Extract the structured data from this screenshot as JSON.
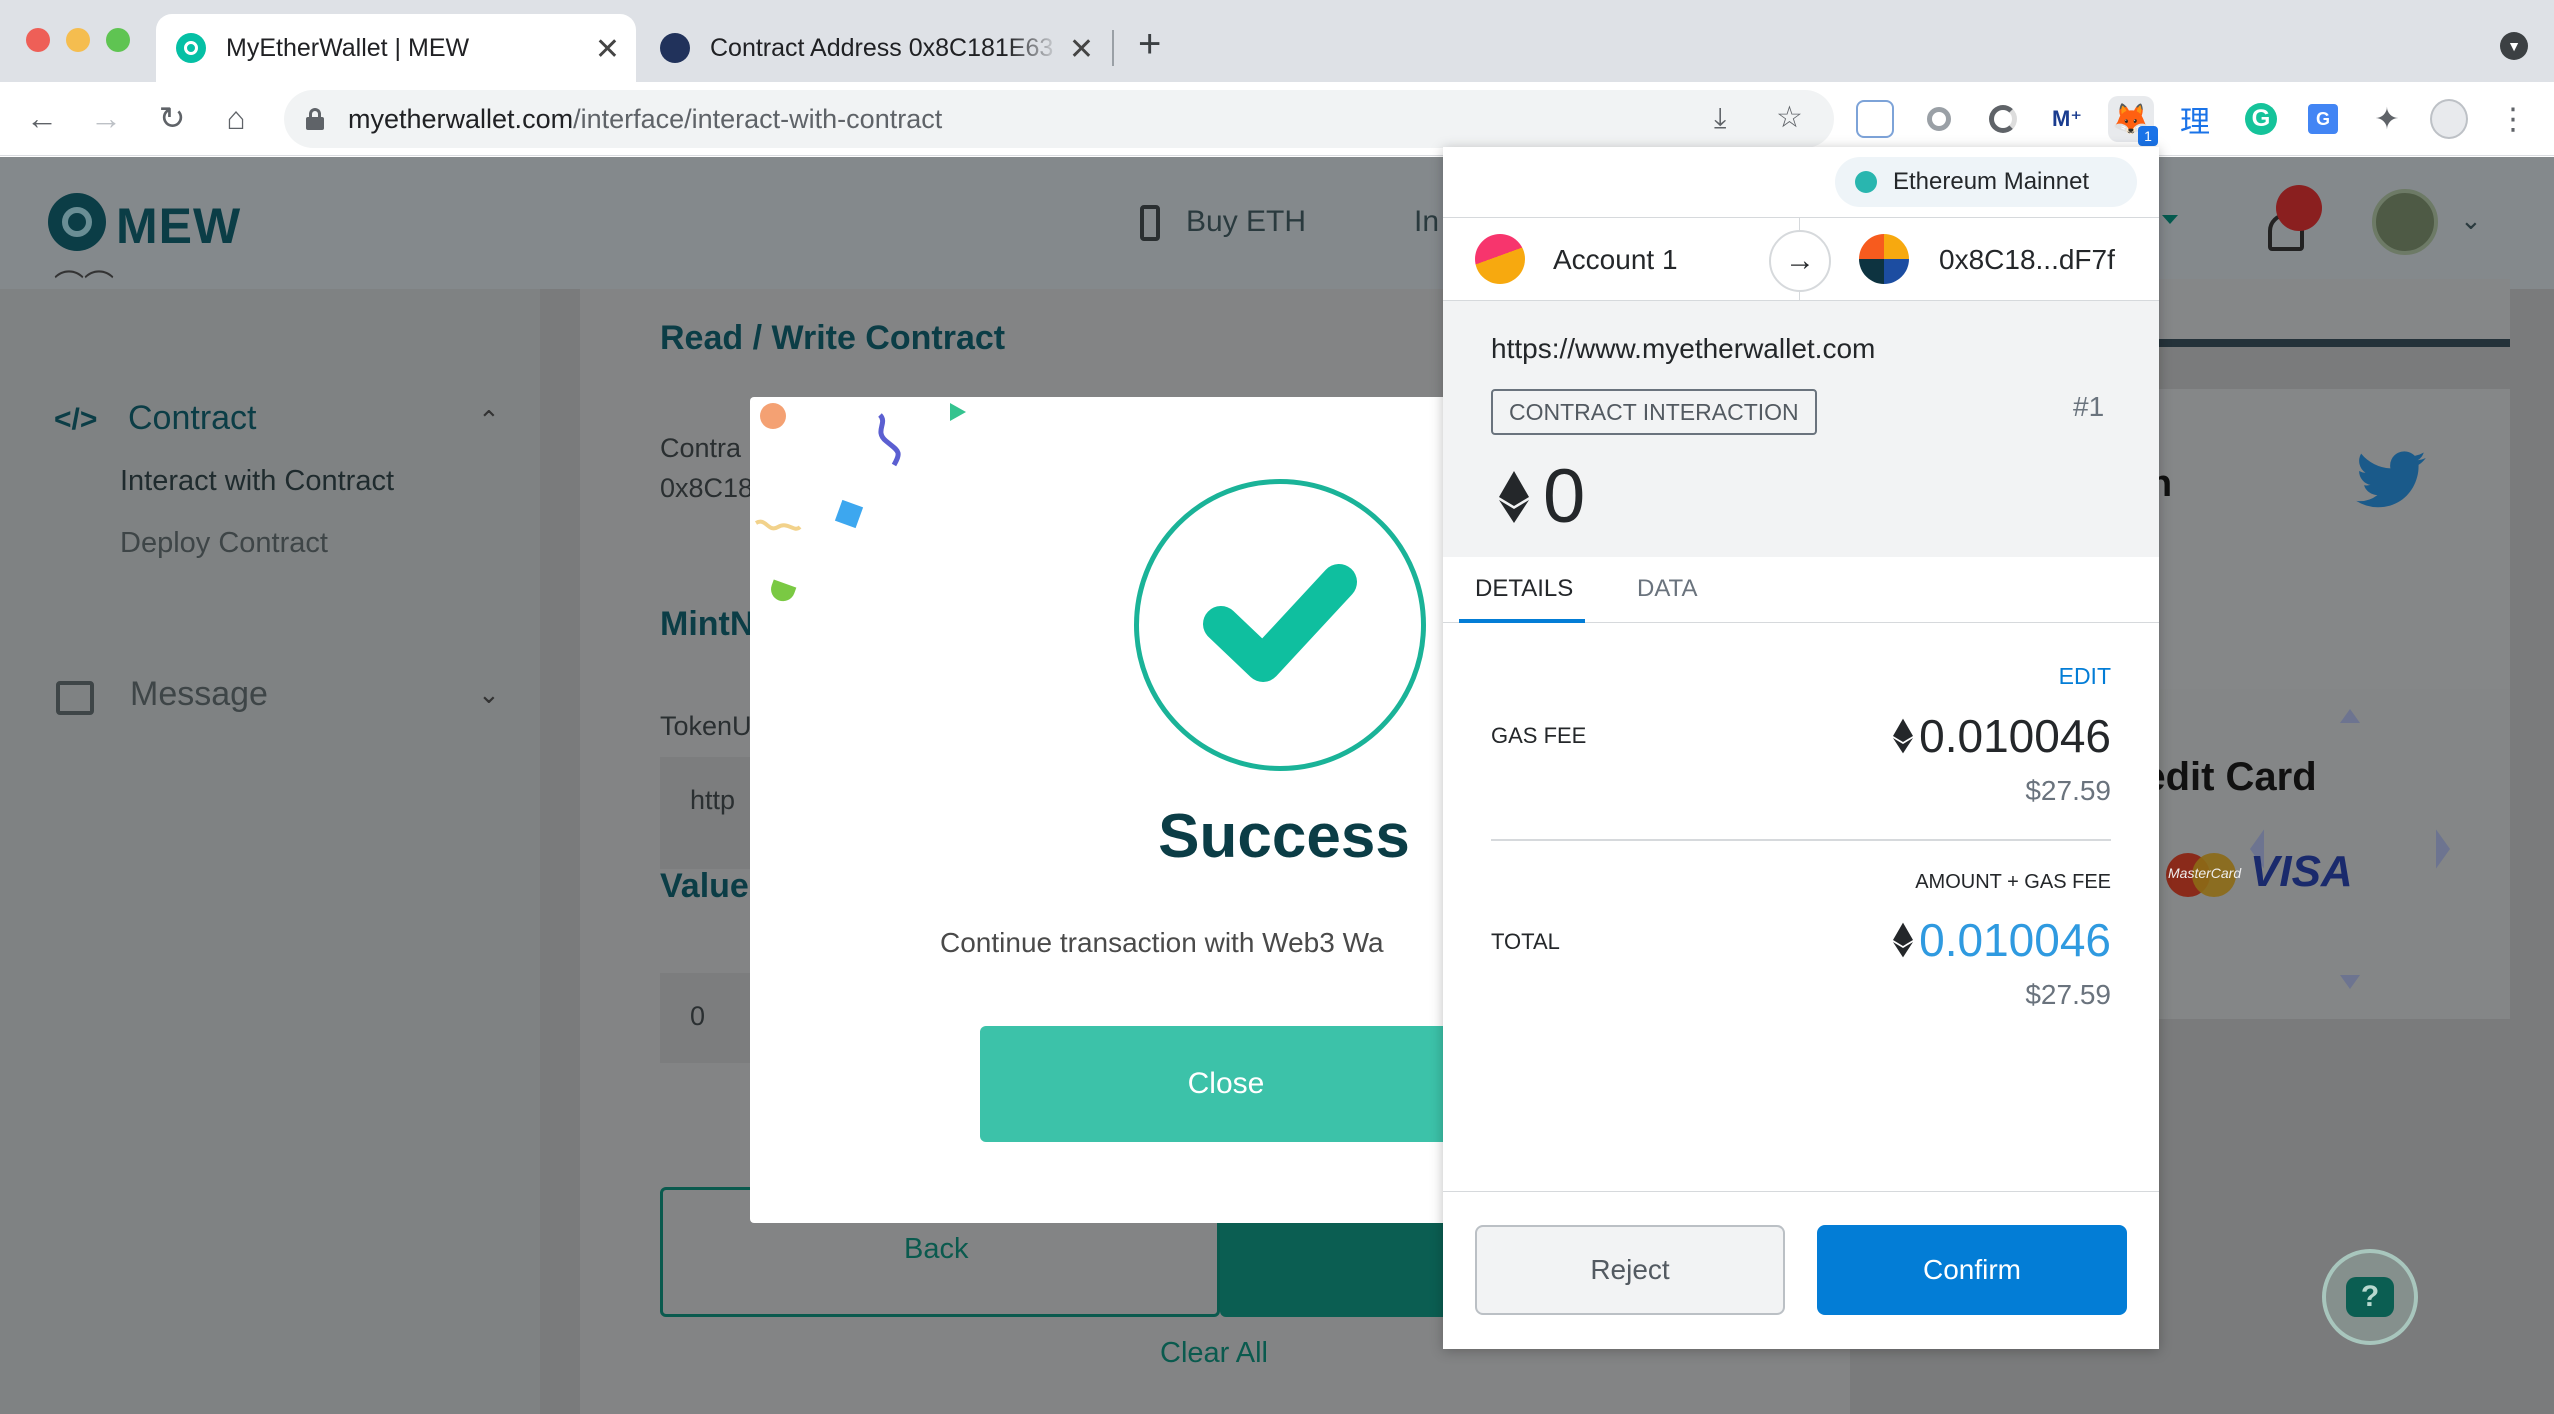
{
  "browser": {
    "tabs": [
      {
        "title": "MyEtherWallet | MEW",
        "active": true
      },
      {
        "title": "Contract Address 0x8C181E63",
        "active": false
      }
    ],
    "url_host": "myetherwallet.com",
    "url_path": "/interface/interact-with-contract",
    "extension_badge": "1"
  },
  "mew": {
    "logo_text": "MEW",
    "nav_buy": "Buy ETH",
    "nav_partial": "In",
    "sidebar": {
      "contract_label": "Contract",
      "items": [
        "Interact with Contract",
        "Deploy Contract"
      ],
      "message_label": "Message"
    },
    "content": {
      "heading": "Read / Write Contract",
      "contract_label_partial": "Contra",
      "contract_addr_partial": "0x8C18",
      "section_partial": "MintN",
      "token_label_partial": "TokenU",
      "token_value_partial": "http",
      "value_label_partial": "Value",
      "value_input": "0",
      "back_button": "Back",
      "clear_all": "Clear All"
    },
    "right": {
      "social_partial": "s on",
      "credit_card_partial": "th Credit Card",
      "mastercard": "MasterCard",
      "visa": "VISA"
    }
  },
  "modal": {
    "title": "Success",
    "message": "Continue transaction with Web3 Wa",
    "close_label": "Close"
  },
  "metamask": {
    "network": "Ethereum Mainnet",
    "account_name": "Account 1",
    "to_address": "0x8C18...dF7f",
    "origin": "https://www.myetherwallet.com",
    "interaction_label": "CONTRACT INTERACTION",
    "tx_number": "#1",
    "amount": "0",
    "tabs": [
      "DETAILS",
      "DATA"
    ],
    "edit_label": "EDIT",
    "gas_fee_label": "GAS FEE",
    "gas_fee_eth": "0.010046",
    "gas_fee_usd": "$27.59",
    "amount_gas_label": "AMOUNT + GAS FEE",
    "total_label": "TOTAL",
    "total_eth": "0.010046",
    "total_usd": "$27.59",
    "reject_label": "Reject",
    "confirm_label": "Confirm"
  },
  "colors": {
    "mew_teal": "#05c0a5",
    "mew_dark": "#003945",
    "metamask_blue": "#037dd6",
    "success_button": "#3cc2a9"
  }
}
